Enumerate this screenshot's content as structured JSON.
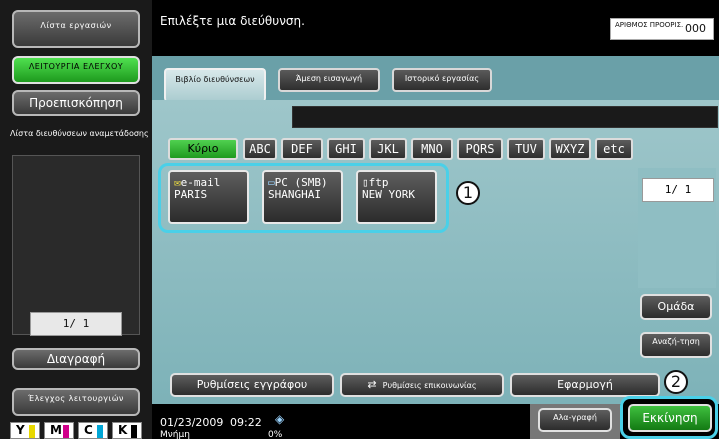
{
  "left": {
    "job_list": "Λίστα εργασιών",
    "functions_check": "ΛΕΙΤΟΥΡΓΙΑ ΕΛΕΓΧΟΥ",
    "preview": "Προεπισκόπηση",
    "address_list_review": "Λίστα διευθύνσεων αναμετάδοσης",
    "page_indicator": "1/ 1",
    "delete": "Διαγραφή",
    "check_settings": "Έλεγχος λειτουργιών"
  },
  "header": {
    "message": "Επιλέξτε μια διεύθυνση.",
    "counter_label": "ΑΡΙΘΜΟΣ ΠΡΟΟΡΙΣ.",
    "counter_value": "000"
  },
  "tabs": [
    {
      "label": "Βιβλίο διευθύνσεων"
    },
    {
      "label": "Άμεση εισαγωγή"
    },
    {
      "label": "Ιστορικό εργασίας"
    }
  ],
  "index_tabs": [
    "Κύριο",
    "ABC",
    "DEF",
    "GHI",
    "JKL",
    "MNO",
    "PQRS",
    "TUV",
    "WXYZ",
    "etc"
  ],
  "destinations": [
    {
      "type": "e-mail",
      "name": "PARIS",
      "icon": "envelope-icon"
    },
    {
      "type": "PC (SMB)",
      "name": "SHANGHAI",
      "icon": "computer-icon"
    },
    {
      "type": "ftp",
      "name": "NEW YORK",
      "icon": "document-icon"
    }
  ],
  "right_panel": {
    "page_indicator": "1/ 1",
    "group": "Ομάδα",
    "search": "Αναζή-τηση"
  },
  "bottom": {
    "document_settings": "Ρυθμίσεις εγγράφου",
    "communication_settings": "Ρυθμίσεις επικοινωνίας",
    "apply": "Εφαρμογή",
    "date": "01/23/2009",
    "time": "09:22",
    "memory_label": "Μνήμη",
    "memory_value": "0%",
    "scan": "Αλα-γραφή",
    "start": "Εκκίνηση"
  },
  "callouts": [
    "1",
    "2"
  ],
  "toner": [
    {
      "label": "Y",
      "color": "#e8d800"
    },
    {
      "label": "M",
      "color": "#d0008a"
    },
    {
      "label": "C",
      "color": "#00a6d6"
    },
    {
      "label": "K",
      "color": "#000000"
    }
  ]
}
